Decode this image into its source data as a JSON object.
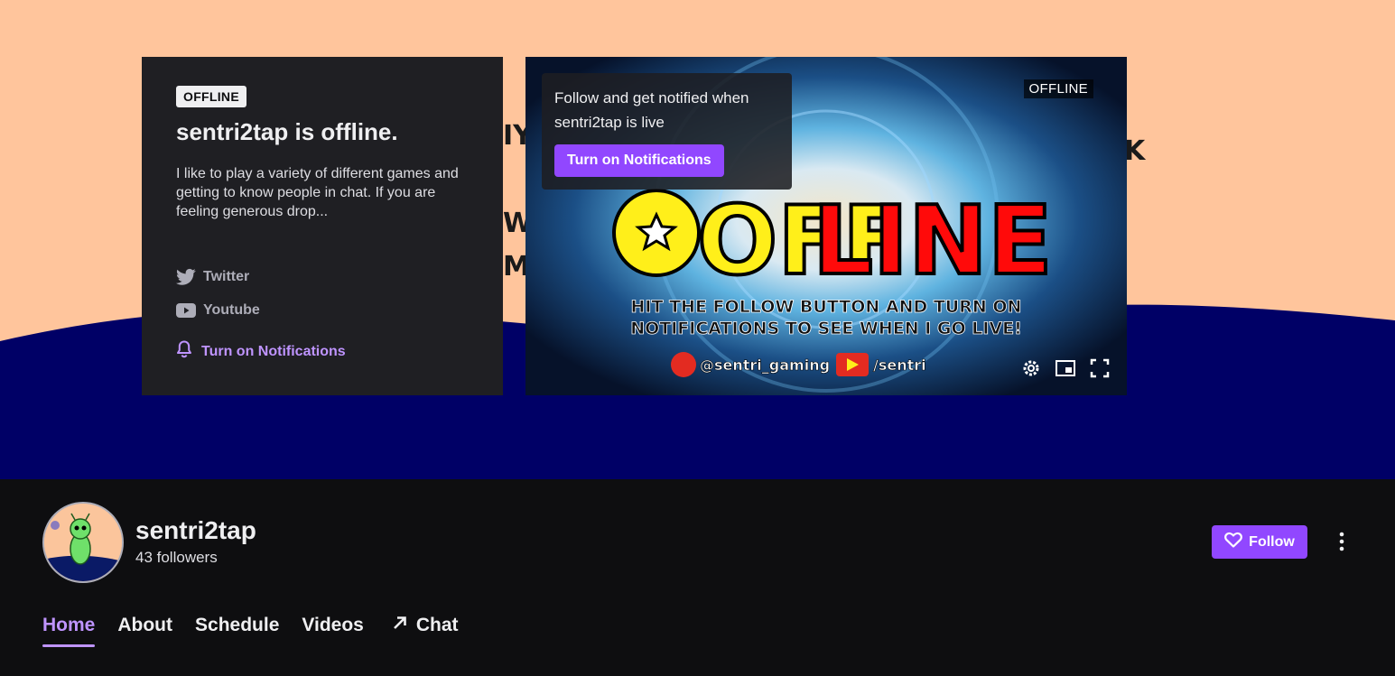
{
  "offline_card": {
    "badge": "OFFLINE",
    "title": "sentri2tap is offline.",
    "description": "I like to play a variety of different games and getting to know people in chat. If you are feeling generous drop...",
    "social": [
      {
        "label": "Twitter",
        "icon": "twitter-icon"
      },
      {
        "label": "Youtube",
        "icon": "youtube-icon"
      }
    ],
    "notifications_label": "Turn on Notifications"
  },
  "player": {
    "popup_text": "Follow and get notified when sentri2tap is live",
    "popup_button": "Turn on Notifications",
    "offline_tag": "OFFLINE",
    "art": {
      "headline_left": "OFF",
      "headline_right": "LINE",
      "line1": "HIT THE FOLLOW BUTTON AND TURN ON",
      "line2": "NOTIFICATIONS TO SEE WHEN I GO LIVE!",
      "twitter_handle": "@sentri_gaming",
      "youtube_handle": "/sentri"
    }
  },
  "channel": {
    "name": "sentri2tap",
    "followers": "43 followers",
    "follow_label": "Follow"
  },
  "tabs": [
    {
      "label": "Home",
      "active": true
    },
    {
      "label": "About"
    },
    {
      "label": "Schedule"
    },
    {
      "label": "Videos"
    },
    {
      "label": "Chat",
      "icon": "arrow-up-right-icon"
    }
  ],
  "colors": {
    "banner_peach": "#ffc59c",
    "banner_navy": "#000066",
    "accent": "#9147ff",
    "accent_text": "#bf94ff"
  }
}
